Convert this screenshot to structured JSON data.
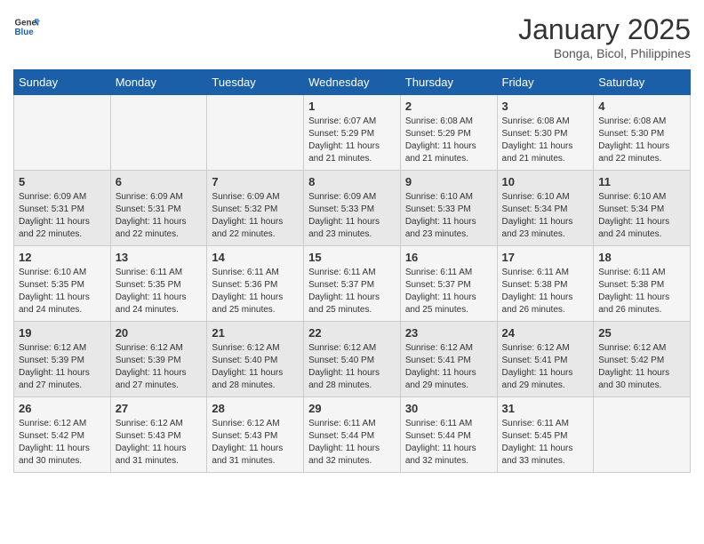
{
  "header": {
    "logo_line1": "General",
    "logo_line2": "Blue",
    "month": "January 2025",
    "location": "Bonga, Bicol, Philippines"
  },
  "weekdays": [
    "Sunday",
    "Monday",
    "Tuesday",
    "Wednesday",
    "Thursday",
    "Friday",
    "Saturday"
  ],
  "weeks": [
    [
      {
        "day": "",
        "sunrise": "",
        "sunset": "",
        "daylight": ""
      },
      {
        "day": "",
        "sunrise": "",
        "sunset": "",
        "daylight": ""
      },
      {
        "day": "",
        "sunrise": "",
        "sunset": "",
        "daylight": ""
      },
      {
        "day": "1",
        "sunrise": "Sunrise: 6:07 AM",
        "sunset": "Sunset: 5:29 PM",
        "daylight": "Daylight: 11 hours and 21 minutes."
      },
      {
        "day": "2",
        "sunrise": "Sunrise: 6:08 AM",
        "sunset": "Sunset: 5:29 PM",
        "daylight": "Daylight: 11 hours and 21 minutes."
      },
      {
        "day": "3",
        "sunrise": "Sunrise: 6:08 AM",
        "sunset": "Sunset: 5:30 PM",
        "daylight": "Daylight: 11 hours and 21 minutes."
      },
      {
        "day": "4",
        "sunrise": "Sunrise: 6:08 AM",
        "sunset": "Sunset: 5:30 PM",
        "daylight": "Daylight: 11 hours and 22 minutes."
      }
    ],
    [
      {
        "day": "5",
        "sunrise": "Sunrise: 6:09 AM",
        "sunset": "Sunset: 5:31 PM",
        "daylight": "Daylight: 11 hours and 22 minutes."
      },
      {
        "day": "6",
        "sunrise": "Sunrise: 6:09 AM",
        "sunset": "Sunset: 5:31 PM",
        "daylight": "Daylight: 11 hours and 22 minutes."
      },
      {
        "day": "7",
        "sunrise": "Sunrise: 6:09 AM",
        "sunset": "Sunset: 5:32 PM",
        "daylight": "Daylight: 11 hours and 22 minutes."
      },
      {
        "day": "8",
        "sunrise": "Sunrise: 6:09 AM",
        "sunset": "Sunset: 5:33 PM",
        "daylight": "Daylight: 11 hours and 23 minutes."
      },
      {
        "day": "9",
        "sunrise": "Sunrise: 6:10 AM",
        "sunset": "Sunset: 5:33 PM",
        "daylight": "Daylight: 11 hours and 23 minutes."
      },
      {
        "day": "10",
        "sunrise": "Sunrise: 6:10 AM",
        "sunset": "Sunset: 5:34 PM",
        "daylight": "Daylight: 11 hours and 23 minutes."
      },
      {
        "day": "11",
        "sunrise": "Sunrise: 6:10 AM",
        "sunset": "Sunset: 5:34 PM",
        "daylight": "Daylight: 11 hours and 24 minutes."
      }
    ],
    [
      {
        "day": "12",
        "sunrise": "Sunrise: 6:10 AM",
        "sunset": "Sunset: 5:35 PM",
        "daylight": "Daylight: 11 hours and 24 minutes."
      },
      {
        "day": "13",
        "sunrise": "Sunrise: 6:11 AM",
        "sunset": "Sunset: 5:35 PM",
        "daylight": "Daylight: 11 hours and 24 minutes."
      },
      {
        "day": "14",
        "sunrise": "Sunrise: 6:11 AM",
        "sunset": "Sunset: 5:36 PM",
        "daylight": "Daylight: 11 hours and 25 minutes."
      },
      {
        "day": "15",
        "sunrise": "Sunrise: 6:11 AM",
        "sunset": "Sunset: 5:37 PM",
        "daylight": "Daylight: 11 hours and 25 minutes."
      },
      {
        "day": "16",
        "sunrise": "Sunrise: 6:11 AM",
        "sunset": "Sunset: 5:37 PM",
        "daylight": "Daylight: 11 hours and 25 minutes."
      },
      {
        "day": "17",
        "sunrise": "Sunrise: 6:11 AM",
        "sunset": "Sunset: 5:38 PM",
        "daylight": "Daylight: 11 hours and 26 minutes."
      },
      {
        "day": "18",
        "sunrise": "Sunrise: 6:11 AM",
        "sunset": "Sunset: 5:38 PM",
        "daylight": "Daylight: 11 hours and 26 minutes."
      }
    ],
    [
      {
        "day": "19",
        "sunrise": "Sunrise: 6:12 AM",
        "sunset": "Sunset: 5:39 PM",
        "daylight": "Daylight: 11 hours and 27 minutes."
      },
      {
        "day": "20",
        "sunrise": "Sunrise: 6:12 AM",
        "sunset": "Sunset: 5:39 PM",
        "daylight": "Daylight: 11 hours and 27 minutes."
      },
      {
        "day": "21",
        "sunrise": "Sunrise: 6:12 AM",
        "sunset": "Sunset: 5:40 PM",
        "daylight": "Daylight: 11 hours and 28 minutes."
      },
      {
        "day": "22",
        "sunrise": "Sunrise: 6:12 AM",
        "sunset": "Sunset: 5:40 PM",
        "daylight": "Daylight: 11 hours and 28 minutes."
      },
      {
        "day": "23",
        "sunrise": "Sunrise: 6:12 AM",
        "sunset": "Sunset: 5:41 PM",
        "daylight": "Daylight: 11 hours and 29 minutes."
      },
      {
        "day": "24",
        "sunrise": "Sunrise: 6:12 AM",
        "sunset": "Sunset: 5:41 PM",
        "daylight": "Daylight: 11 hours and 29 minutes."
      },
      {
        "day": "25",
        "sunrise": "Sunrise: 6:12 AM",
        "sunset": "Sunset: 5:42 PM",
        "daylight": "Daylight: 11 hours and 30 minutes."
      }
    ],
    [
      {
        "day": "26",
        "sunrise": "Sunrise: 6:12 AM",
        "sunset": "Sunset: 5:42 PM",
        "daylight": "Daylight: 11 hours and 30 minutes."
      },
      {
        "day": "27",
        "sunrise": "Sunrise: 6:12 AM",
        "sunset": "Sunset: 5:43 PM",
        "daylight": "Daylight: 11 hours and 31 minutes."
      },
      {
        "day": "28",
        "sunrise": "Sunrise: 6:12 AM",
        "sunset": "Sunset: 5:43 PM",
        "daylight": "Daylight: 11 hours and 31 minutes."
      },
      {
        "day": "29",
        "sunrise": "Sunrise: 6:11 AM",
        "sunset": "Sunset: 5:44 PM",
        "daylight": "Daylight: 11 hours and 32 minutes."
      },
      {
        "day": "30",
        "sunrise": "Sunrise: 6:11 AM",
        "sunset": "Sunset: 5:44 PM",
        "daylight": "Daylight: 11 hours and 32 minutes."
      },
      {
        "day": "31",
        "sunrise": "Sunrise: 6:11 AM",
        "sunset": "Sunset: 5:45 PM",
        "daylight": "Daylight: 11 hours and 33 minutes."
      },
      {
        "day": "",
        "sunrise": "",
        "sunset": "",
        "daylight": ""
      }
    ]
  ]
}
